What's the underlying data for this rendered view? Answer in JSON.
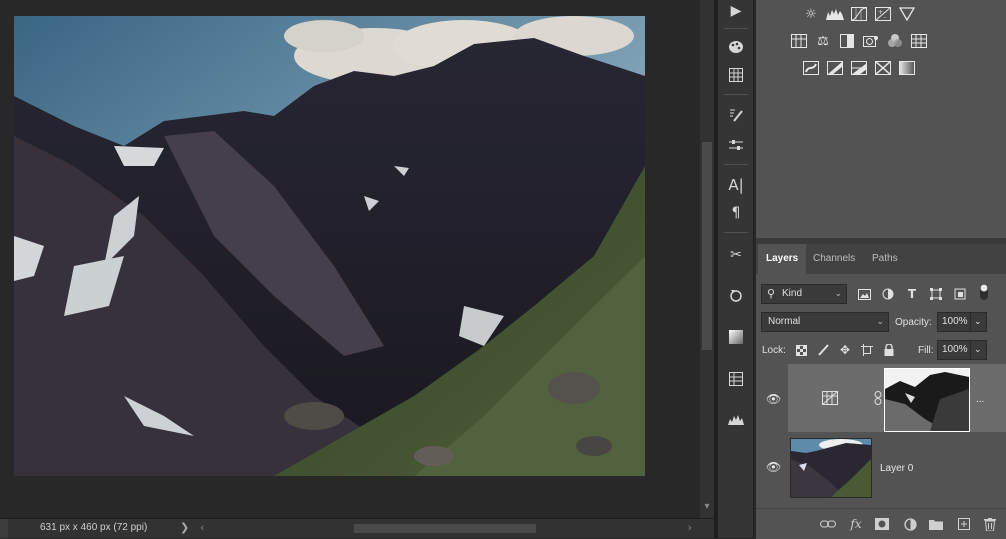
{
  "document": {
    "info": "631 px x 460 px (72 ppi)",
    "nav_arrow": "❯"
  },
  "toolstrip": {
    "icons": [
      "play-icon",
      "color-palette-icon",
      "grid-icon",
      "brush-history-icon",
      "sliders-icon",
      "character-icon",
      "paragraph-icon",
      "scissors-icon",
      "clone-source-icon",
      "gradient-swatch-icon",
      "table-icon",
      "histogram-icon"
    ]
  },
  "adjustments": {
    "rows": [
      [
        "brightness-icon",
        "levels-icon",
        "curves-icon",
        "exposure-icon",
        "triangle-icon"
      ],
      [
        "vibrance-icon",
        "hue-saturation-icon",
        "color-balance-icon",
        "black-white-icon",
        "photo-filter-icon",
        "channel-mixer-icon",
        "color-lookup-icon"
      ],
      [
        "invert-icon",
        "posterize-icon",
        "threshold-icon",
        "selective-color-icon",
        "gradient-map-icon"
      ]
    ]
  },
  "layers_panel": {
    "tabs": [
      {
        "label": "Layers",
        "active": true
      },
      {
        "label": "Channels",
        "active": false
      },
      {
        "label": "Paths",
        "active": false
      }
    ],
    "filter": {
      "label": "Kind"
    },
    "blend_mode": "Normal",
    "opacity_label": "Opacity:",
    "opacity_value": "100%",
    "lock_label": "Lock:",
    "fill_label": "Fill:",
    "fill_value": "100%",
    "layers": [
      {
        "name": "",
        "type": "adjustment",
        "selected": true,
        "visible": true
      },
      {
        "name": "Layer 0",
        "type": "image",
        "selected": false,
        "visible": true
      }
    ],
    "more_label": "..."
  },
  "colors": {
    "sky": "#5f8ca8",
    "mountain": "#2a2733",
    "grass": "#3f4e2f",
    "panel": "#535353",
    "selected_row": "#6c6c6c"
  }
}
